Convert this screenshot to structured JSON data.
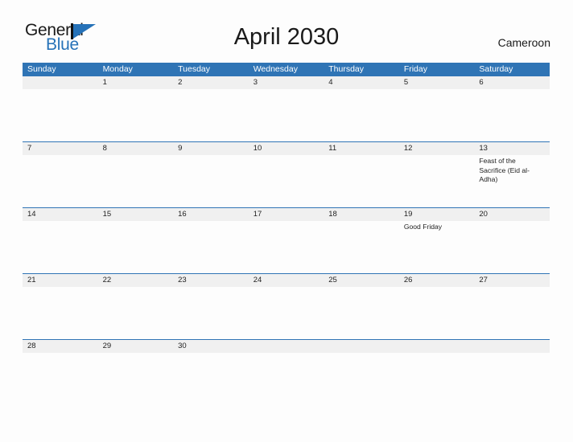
{
  "logo": {
    "word_top": "General",
    "word_bottom": "Blue",
    "triangle_icon": "triangle-flag-icon",
    "accent_color": "#2672b8"
  },
  "header": {
    "title": "April 2030",
    "country": "Cameroon"
  },
  "colors": {
    "header_blue": "#2f74b5",
    "date_band_gray": "#f0f0f0",
    "page_background": "#fdfdfd",
    "text": "#1a1a1a"
  },
  "calendar": {
    "weekdays": [
      "Sunday",
      "Monday",
      "Tuesday",
      "Wednesday",
      "Thursday",
      "Friday",
      "Saturday"
    ],
    "weeks": [
      {
        "days": [
          {
            "date": "",
            "event": ""
          },
          {
            "date": "1",
            "event": ""
          },
          {
            "date": "2",
            "event": ""
          },
          {
            "date": "3",
            "event": ""
          },
          {
            "date": "4",
            "event": ""
          },
          {
            "date": "5",
            "event": ""
          },
          {
            "date": "6",
            "event": ""
          }
        ]
      },
      {
        "days": [
          {
            "date": "7",
            "event": ""
          },
          {
            "date": "8",
            "event": ""
          },
          {
            "date": "9",
            "event": ""
          },
          {
            "date": "10",
            "event": ""
          },
          {
            "date": "11",
            "event": ""
          },
          {
            "date": "12",
            "event": ""
          },
          {
            "date": "13",
            "event": "Feast of the Sacrifice (Eid al-Adha)"
          }
        ]
      },
      {
        "days": [
          {
            "date": "14",
            "event": ""
          },
          {
            "date": "15",
            "event": ""
          },
          {
            "date": "16",
            "event": ""
          },
          {
            "date": "17",
            "event": ""
          },
          {
            "date": "18",
            "event": ""
          },
          {
            "date": "19",
            "event": "Good Friday"
          },
          {
            "date": "20",
            "event": ""
          }
        ]
      },
      {
        "days": [
          {
            "date": "21",
            "event": ""
          },
          {
            "date": "22",
            "event": ""
          },
          {
            "date": "23",
            "event": ""
          },
          {
            "date": "24",
            "event": ""
          },
          {
            "date": "25",
            "event": ""
          },
          {
            "date": "26",
            "event": ""
          },
          {
            "date": "27",
            "event": ""
          }
        ]
      },
      {
        "days": [
          {
            "date": "28",
            "event": ""
          },
          {
            "date": "29",
            "event": ""
          },
          {
            "date": "30",
            "event": ""
          },
          {
            "date": "",
            "event": ""
          },
          {
            "date": "",
            "event": ""
          },
          {
            "date": "",
            "event": ""
          },
          {
            "date": "",
            "event": ""
          }
        ]
      }
    ]
  }
}
